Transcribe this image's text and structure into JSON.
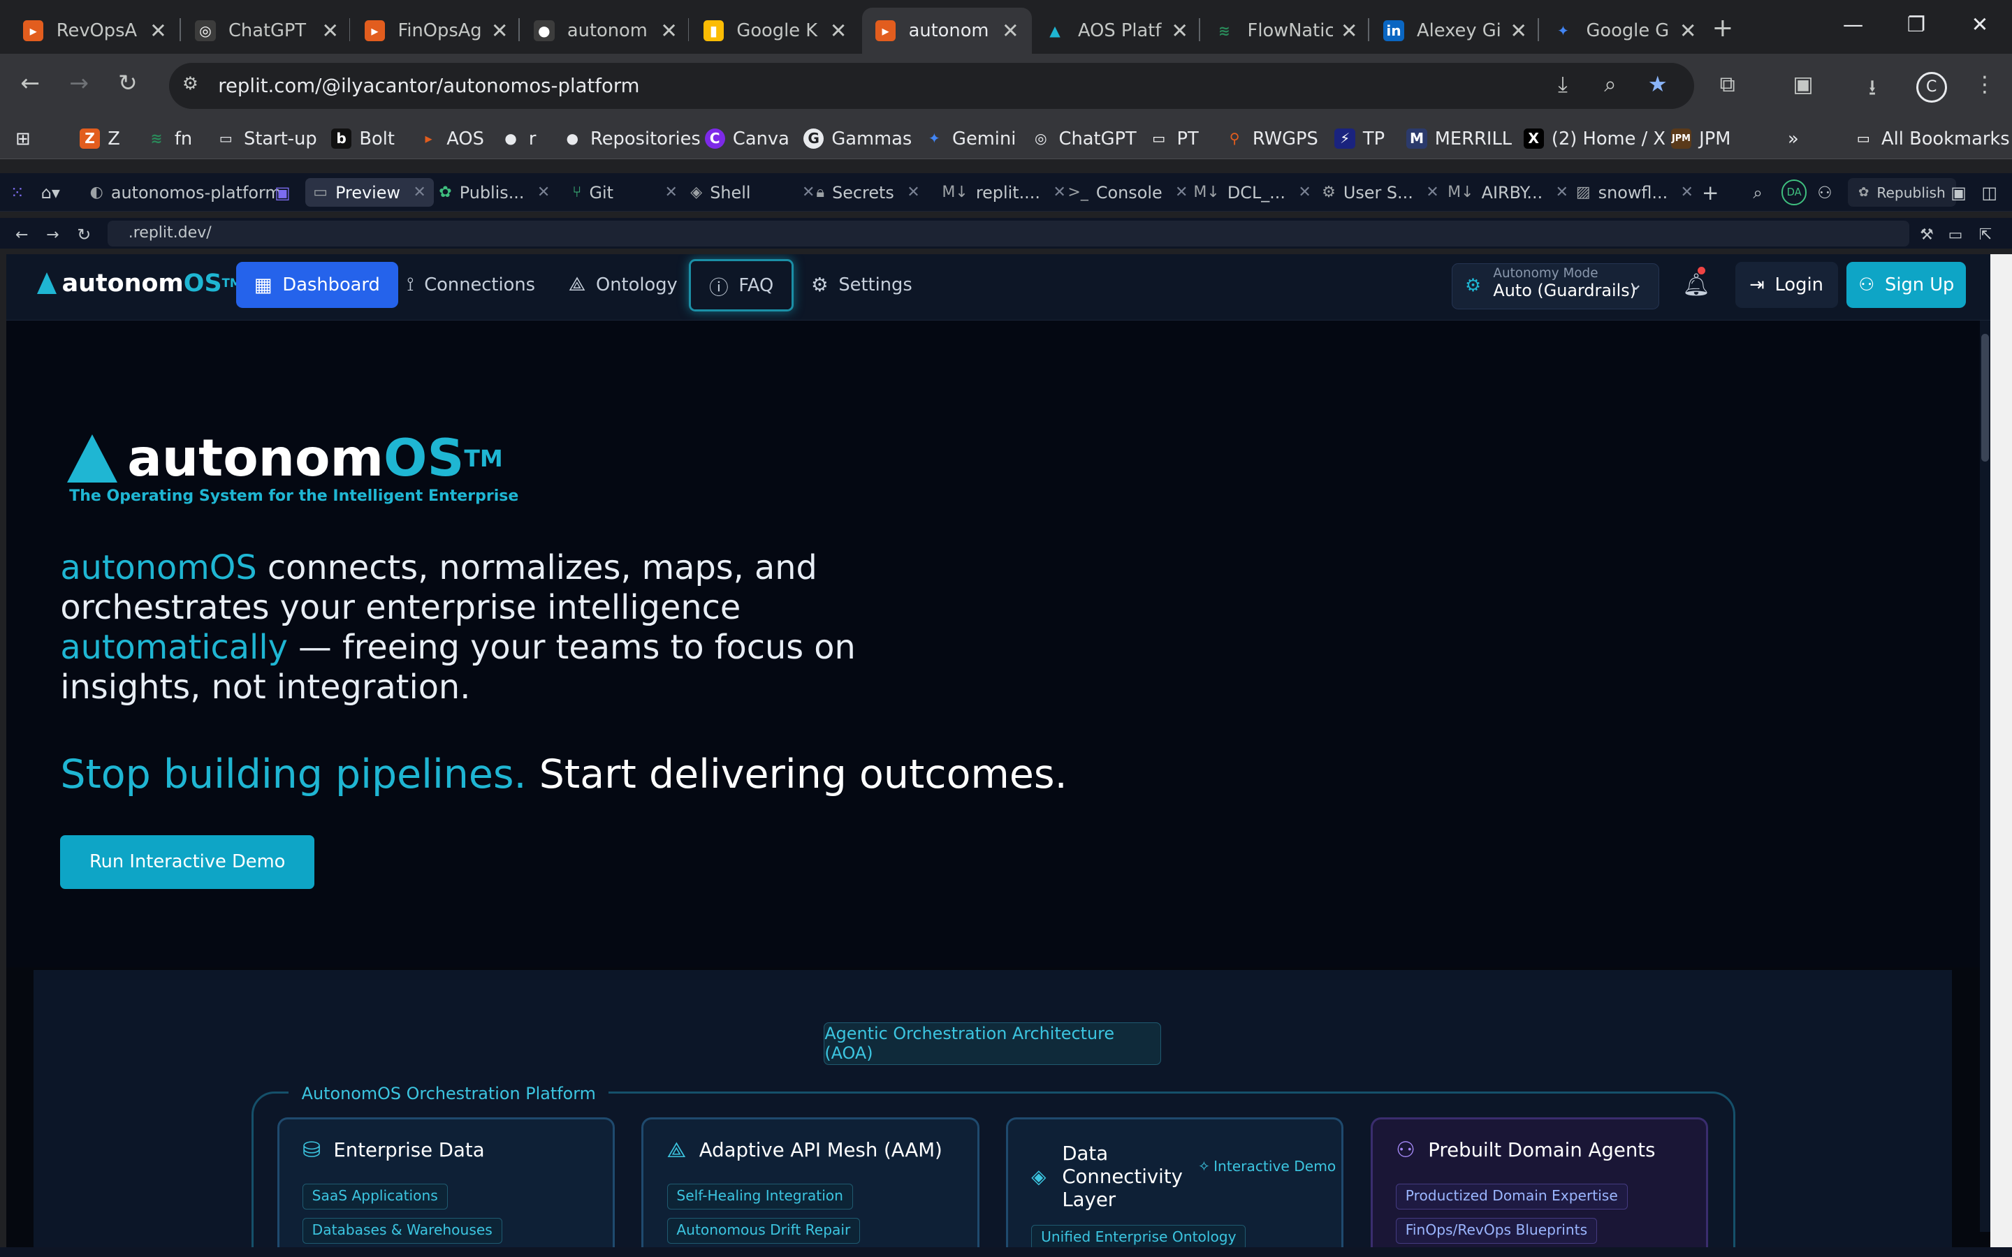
{
  "browser": {
    "tabs": [
      {
        "title": "RevOpsA",
        "icon": "bars-orange",
        "color": "#e25d1e"
      },
      {
        "title": "ChatGPT",
        "icon": "openai",
        "color": "#3c3c3c"
      },
      {
        "title": "FinOpsAg",
        "icon": "bars-orange",
        "color": "#e25d1e"
      },
      {
        "title": "autonom",
        "icon": "github",
        "color": "#3c3c3c"
      },
      {
        "title": "Google K",
        "icon": "keep",
        "color": "#fbbc04"
      },
      {
        "title": "autonom",
        "icon": "bars-orange",
        "color": "#e25d1e"
      },
      {
        "title": "AOS Platf",
        "icon": "aos",
        "color": "#1fb6d3"
      },
      {
        "title": "FlowNatic",
        "icon": "flow",
        "color": "#2a8a5a"
      },
      {
        "title": "Alexey Gi",
        "icon": "linkedin",
        "color": "#0a66c2"
      },
      {
        "title": "Google G",
        "icon": "gemini",
        "color": "#4285f4"
      }
    ],
    "active_tab": 5,
    "url": "replit.com/@ilyacantor/autonomos-platform",
    "profile_letter": "C",
    "bookmarks": [
      "Z",
      "fn",
      "Start-up",
      "Bolt",
      "AOS",
      "r",
      "Repositories",
      "Canva",
      "Gammas",
      "Gemini",
      "ChatGPT",
      "PT",
      "RWGPS",
      "TP",
      "MERRILL",
      "(2) Home / X",
      "JPM"
    ],
    "all_bookmarks": "All Bookmarks"
  },
  "replit": {
    "repl_name": "autonomos-platform",
    "tabs": [
      "Preview",
      "Publis...",
      "Git",
      "Shell",
      "Secrets",
      "replit....",
      "Console",
      "DCL_...",
      "User S...",
      "AIRBY...",
      "snowfl..."
    ],
    "avatar": "DA",
    "republish": "Republish",
    "preview_url": ".replit.dev/"
  },
  "app": {
    "logo_main": "autonom",
    "logo_os": "OS",
    "logo_tm": "TM",
    "nav": {
      "dashboard": "Dashboard",
      "connections": "Connections",
      "ontology": "Ontology",
      "faq": "FAQ",
      "settings": "Settings"
    },
    "mode_label": "Autonomy Mode",
    "mode_value": "Auto (Guardrails)",
    "login": "Login",
    "signup": "Sign Up"
  },
  "hero": {
    "logo_main": "autonom",
    "logo_os": "OS",
    "logo_tm": "TM",
    "tagline": "The Operating System for the Intelligent Enterprise",
    "lead_1": "autonomOS",
    "lead_2": " connects, normalizes, maps, and orchestrates your enterprise intelligence ",
    "lead_3": "automatically",
    "lead_4": " — freeing your teams to focus on insights, not integration.",
    "stop_1": "Stop building pipelines.",
    "stop_2": " Start delivering outcomes.",
    "cta": "Run Interactive Demo"
  },
  "architecture": {
    "badge": "Agentic Orchestration Architecture (AOA)",
    "platform_label": "AutonomOS Orchestration Platform",
    "cards": [
      {
        "title": "Enterprise Data",
        "pills": [
          "SaaS Applications",
          "Databases & Warehouses"
        ]
      },
      {
        "title": "Adaptive API Mesh (AAM)",
        "pills": [
          "Self-Healing Integration",
          "Autonomous Drift Repair"
        ]
      },
      {
        "title": "Data Connectivity Layer",
        "link": "Interactive Demo",
        "pills": [
          "Unified Enterprise Ontology"
        ]
      },
      {
        "title": "Prebuilt Domain Agents",
        "pills": [
          "Productized Domain Expertise",
          "FinOps/RevOps Blueprints"
        ]
      }
    ]
  }
}
